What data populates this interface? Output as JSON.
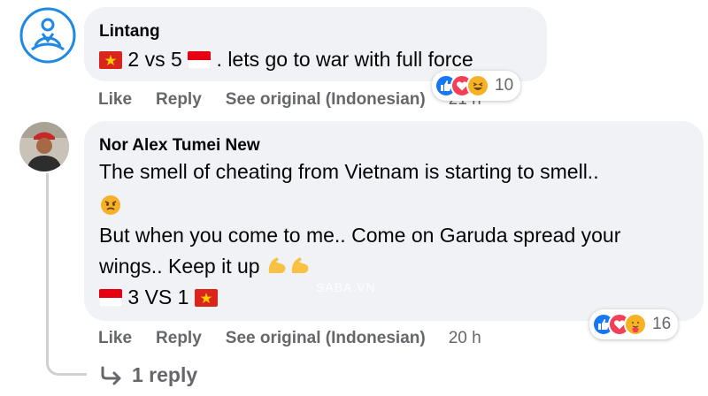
{
  "comments": [
    {
      "author": "Lintang",
      "line1": {
        "score": "2 vs 5",
        "rest": ". lets go to war with full force"
      },
      "actions": {
        "like": "Like",
        "reply": "Reply",
        "see_original": "See original (Indonesian)",
        "time": "21 h"
      },
      "reactions": {
        "types": [
          "like-icon",
          "love-icon",
          "haha-icon"
        ],
        "count": "10"
      }
    },
    {
      "author": "Nor Alex Tumei New",
      "line1": "The smell of cheating from Vietnam is starting to smell..",
      "line2": "But when you come to me.. Come on Garuda spread your",
      "line3": "wings.. Keep it up",
      "score_line": "3 VS 1",
      "actions": {
        "like": "Like",
        "reply": "Reply",
        "see_original": "See original (Indonesian)",
        "time": "20 h"
      },
      "reactions": {
        "types": [
          "like-icon",
          "love-icon",
          "care-icon"
        ],
        "count": "16"
      },
      "replies_label": "1 reply"
    }
  ],
  "watermark": "SABA.VN",
  "colors": {
    "bubble": "#f0f2f5",
    "secondary_text": "#65676b",
    "like_blue": "#1877f2",
    "love_red": "#f33e58",
    "haha_yellow": "#f7b125",
    "vietnam_red": "#da251d",
    "indonesia_red": "#e70011"
  }
}
